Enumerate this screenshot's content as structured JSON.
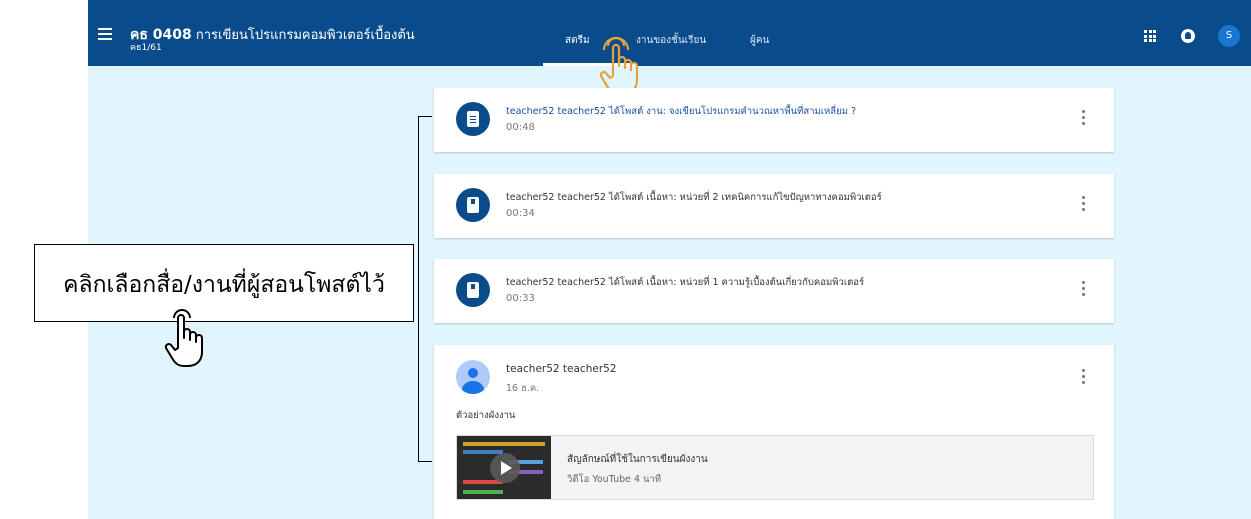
{
  "header": {
    "course_code": "คธ 0408",
    "course_name": "การเขียนโปรแกรมคอมพิวเตอร์เบื้องต้น",
    "section": "คธ1/61",
    "tabs": [
      "สตรีม",
      "งานของชั้นเรียน",
      "ผู้คน"
    ],
    "active_tab": "สตรีม",
    "user_initial": "S"
  },
  "posts": [
    {
      "type": "assignment",
      "icon": "assignment-icon",
      "title": "teacher52 teacher52 ได้โพสต์ งาน: จงเขียนโปรแกรมคำนวณหาพื้นที่สามเหลี่ยม ?",
      "time": "00:48"
    },
    {
      "type": "material",
      "icon": "book-icon",
      "title": "teacher52 teacher52 ได้โพสต์ เนื้อหา: หน่วยที่ 2 เทคนิคการแก้ไขปัญหาทางคอมพิวเตอร์",
      "time": "00:34"
    },
    {
      "type": "material",
      "icon": "book-icon",
      "title": "teacher52 teacher52 ได้โพสต์ เนื้อหา: หน่วยที่ 1 ความรู้เบื้องต้นเกี่ยวกับคอมพิวเตอร์",
      "time": "00:33"
    }
  ],
  "announcement": {
    "author": "teacher52 teacher52",
    "date": "16 ธ.ค.",
    "text": "ตัวอย่างผังงาน",
    "attachment": {
      "title": "สัญลักษณ์ที่ใช้ในการเขียนผังงาน",
      "subtitle": "วิดีโอ YouTube   4 นาที"
    }
  },
  "callout": {
    "text": "คลิกเลือกสื่อ/งานที่ผู้สอนโพสต์ไว้"
  },
  "colors": {
    "header_bg": "#0a4b8c",
    "stream_bg": "#e1f5fe",
    "accent_hand": "#e6a33c"
  }
}
